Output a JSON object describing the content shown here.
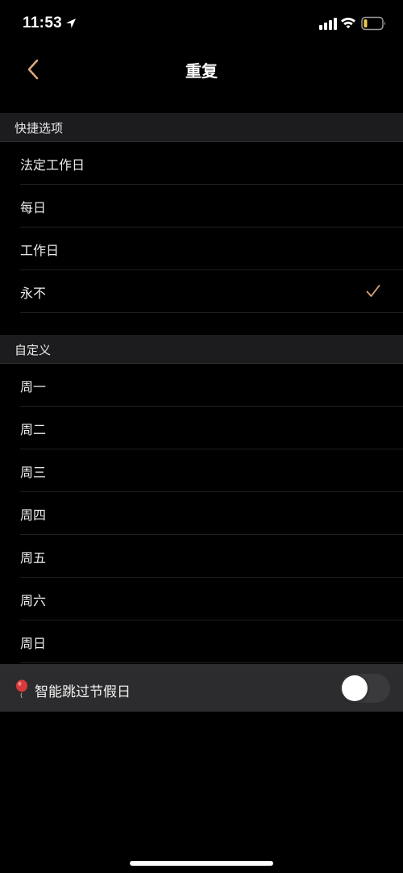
{
  "status_bar": {
    "time": "11:53",
    "icons": [
      "location-arrow-icon",
      "signal-icon",
      "wifi-icon",
      "battery-icon"
    ]
  },
  "nav": {
    "title": "重复",
    "back_icon": "chevron-left-icon"
  },
  "quick_options": {
    "header": "快捷选项",
    "items": [
      {
        "label": "法定工作日",
        "selected": false
      },
      {
        "label": "每日",
        "selected": false
      },
      {
        "label": "工作日",
        "selected": false
      },
      {
        "label": "永不",
        "selected": true
      }
    ]
  },
  "custom": {
    "header": "自定义",
    "days": [
      "周一",
      "周二",
      "周三",
      "周四",
      "周五",
      "周六",
      "周日"
    ]
  },
  "smart_skip": {
    "icon": "balloon-icon",
    "label": "智能跳过节假日",
    "enabled": false
  },
  "colors": {
    "accent": "#d9a57a",
    "background": "#000000",
    "section_header": "#1c1c1e",
    "smart_row": "#2c2c2e"
  }
}
